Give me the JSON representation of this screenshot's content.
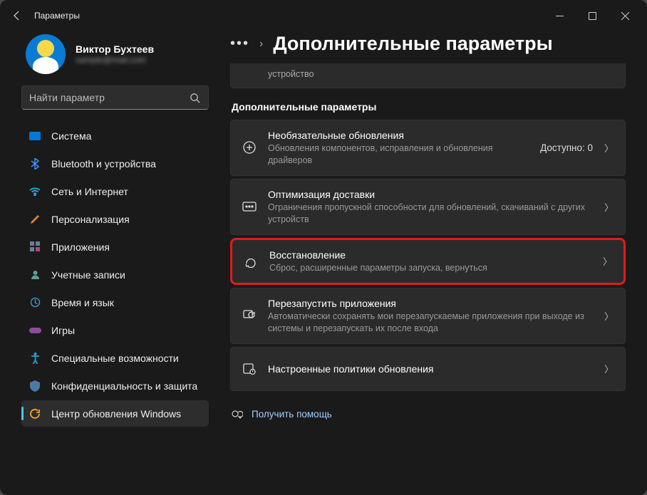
{
  "window": {
    "title": "Параметры"
  },
  "profile": {
    "name": "Виктор Бухтеев",
    "email": "sample@mail.com"
  },
  "search": {
    "placeholder": "Найти параметр"
  },
  "nav": {
    "items": [
      {
        "label": "Система"
      },
      {
        "label": "Bluetooth и устройства"
      },
      {
        "label": "Сеть и Интернет"
      },
      {
        "label": "Персонализация"
      },
      {
        "label": "Приложения"
      },
      {
        "label": "Учетные записи"
      },
      {
        "label": "Время и язык"
      },
      {
        "label": "Игры"
      },
      {
        "label": "Специальные возможности"
      },
      {
        "label": "Конфиденциальность и защита"
      },
      {
        "label": "Центр обновления Windows"
      }
    ]
  },
  "breadcrumb": {
    "page": "Дополнительные параметры"
  },
  "stub": {
    "text": "устройство"
  },
  "section": {
    "header": "Дополнительные параметры"
  },
  "cards": {
    "optional": {
      "title": "Необязательные обновления",
      "sub": "Обновления компонентов, исправления и обновления драйверов",
      "value": "Доступно: 0"
    },
    "delivery": {
      "title": "Оптимизация доставки",
      "sub": "Ограничения пропускной способности для обновлений, скачиваний с других устройств"
    },
    "recovery": {
      "title": "Восстановление",
      "sub": "Сброс, расширенные параметры запуска, вернуться"
    },
    "restart_apps": {
      "title": "Перезапустить приложения",
      "sub": "Автоматически сохранять мои перезапускаемые приложения при выходе из системы и перезапускать их после входа"
    },
    "policies": {
      "title": "Настроенные политики обновления"
    }
  },
  "help": {
    "label": "Получить помощь"
  }
}
